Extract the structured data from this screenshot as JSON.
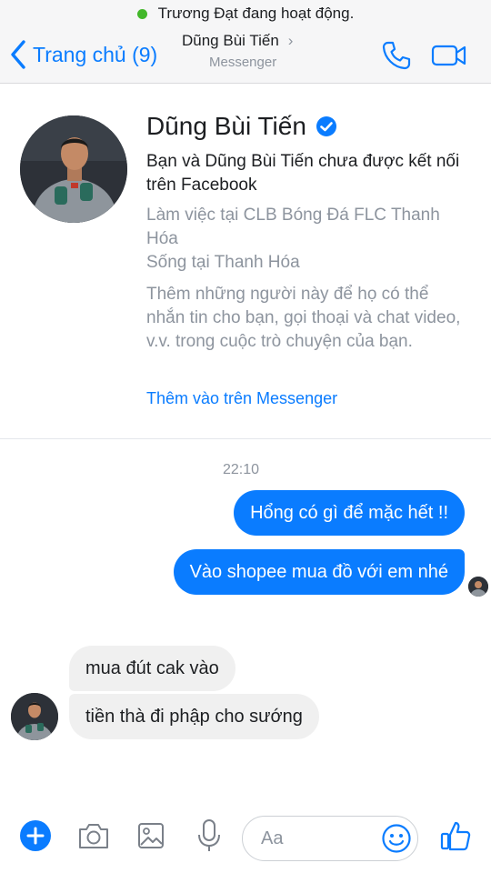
{
  "status_bar": {
    "active_text": "Trương Đạt đang hoạt động."
  },
  "header": {
    "back_label": "Trang chủ (9)",
    "contact_name": "Dũng Bùi Tiến",
    "chevron": "›",
    "subtitle": "Messenger",
    "icons": [
      "back-chevron-icon",
      "phone-icon",
      "video-camera-icon"
    ]
  },
  "profile": {
    "name": "Dũng Bùi Tiến",
    "verified_icon": "verified-badge-icon",
    "connection_text": "Bạn và Dũng Bùi Tiến chưa được kết nối trên Facebook",
    "work_text": "Làm việc tại CLB Bóng Đá FLC Thanh Hóa",
    "lives_text": "Sống tại Thanh Hóa",
    "note_text": "Thêm những người này để họ có thể nhắn tin cho bạn, gọi thoại và chat video, v.v. trong cuộc trò chuyện của bạn.",
    "add_link": "Thêm vào trên Messenger"
  },
  "conversation": {
    "timestamp": "22:10",
    "messages": [
      {
        "direction": "outgoing",
        "text": "Hổng có gì để mặc hết !!"
      },
      {
        "direction": "outgoing",
        "text": "Vào shopee mua đồ với em nhé"
      },
      {
        "direction": "incoming",
        "text": "mua đút cak vào"
      },
      {
        "direction": "incoming",
        "text": "tiền thà đi phập cho sướng"
      }
    ]
  },
  "composer": {
    "placeholder": "Aa",
    "icons": [
      "plus-icon",
      "camera-icon",
      "image-icon",
      "microphone-icon",
      "emoji-icon",
      "thumbs-up-icon"
    ]
  },
  "colors": {
    "accent": "#0a7cff",
    "active_dot": "#42b72a",
    "incoming_bubble": "#f0f0f0",
    "muted_text": "#8d949e"
  }
}
